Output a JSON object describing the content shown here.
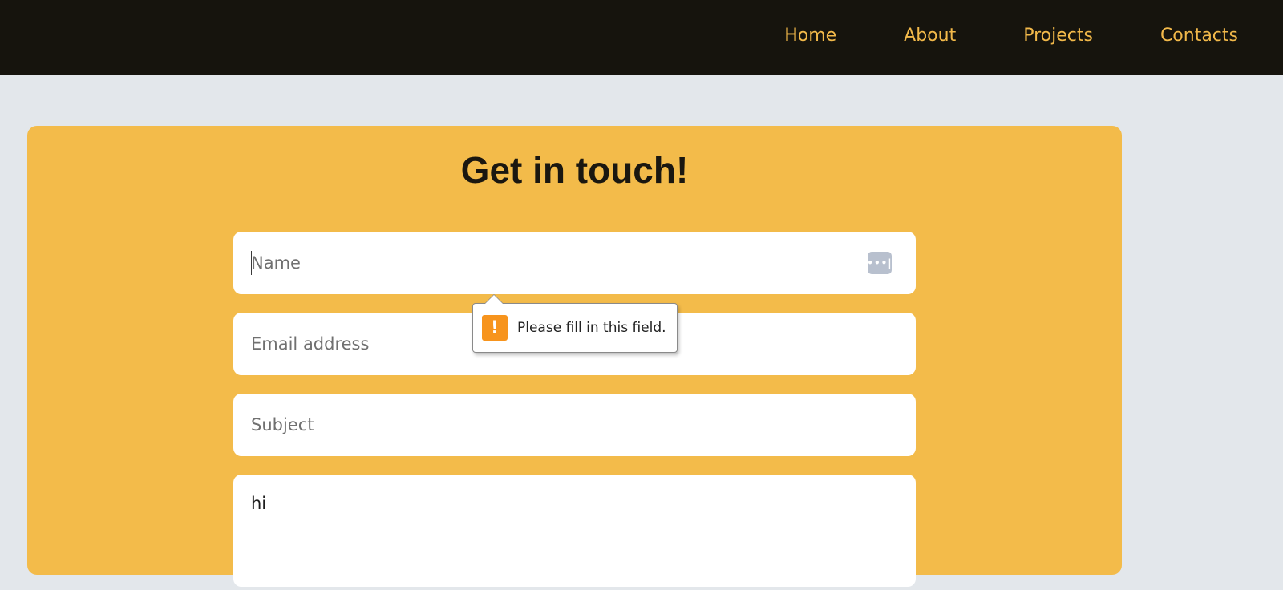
{
  "nav": {
    "items": [
      {
        "label": "Home"
      },
      {
        "label": "About"
      },
      {
        "label": "Projects"
      },
      {
        "label": "Contacts"
      }
    ]
  },
  "form": {
    "title": "Get in touch!",
    "name": {
      "placeholder": "Name",
      "value": ""
    },
    "email": {
      "placeholder": "Email address",
      "value": ""
    },
    "subject": {
      "placeholder": "Subject",
      "value": ""
    },
    "message": {
      "value": "hi"
    }
  },
  "validation": {
    "message": "Please fill in this field.",
    "icon": "!"
  },
  "password_manager": {
    "icon": "•••|"
  },
  "colors": {
    "header_bg": "#16140d",
    "nav_text": "#f2b94a",
    "card_bg": "#f3bb4a",
    "page_bg": "#e3e7eb",
    "warning": "#f7941d"
  }
}
